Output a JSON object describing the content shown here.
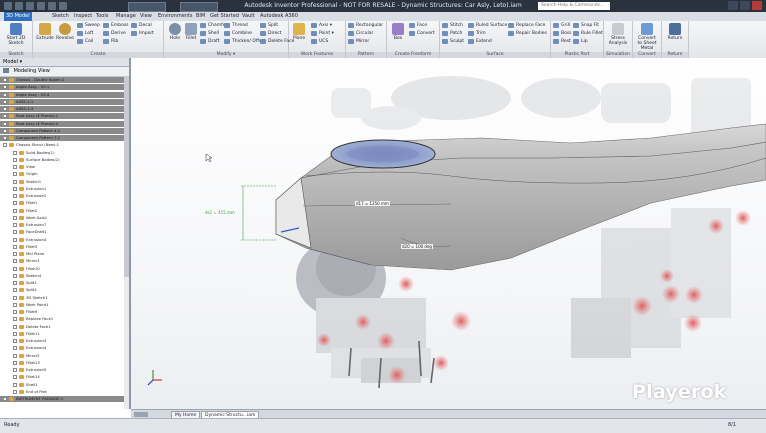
{
  "app": {
    "title": "Autodesk Inventor Professional  -  NOT FOR RESALE  -  Dynamic Structures: Car Asly, Leto).iam",
    "search_placeholder": "Search Help & Commands..."
  },
  "ribbon_tabs": [
    "3D Model",
    "Sketch",
    "Inspect",
    "Tools",
    "Manage",
    "View",
    "Environments",
    "BIM",
    "Get Started",
    "Vault",
    "Autodesk A360"
  ],
  "ribbon": {
    "sketch": {
      "label": "Sketch",
      "start_sketch": "Start 2D Sketch"
    },
    "create": {
      "label": "Create",
      "extrude": "Extrude",
      "revolve": "Revolve",
      "sweep": "Sweep",
      "loft": "Loft",
      "coil": "Coil",
      "emboss": "Emboss",
      "derive": "Derive",
      "rib": "Rib",
      "decal": "Decal",
      "import": "Import"
    },
    "modify": {
      "label": "Modify ▾",
      "hole": "Hole",
      "fillet": "Fillet",
      "chamfer": "Chamfer",
      "shell": "Shell",
      "draft": "Draft",
      "thread": "Thread",
      "combine": "Combine",
      "thicken": "Thicken/ Offset",
      "split": "Split",
      "direct": "Direct",
      "delete_face": "Delete Face"
    },
    "work_features": {
      "label": "Work Features",
      "plane": "Plane",
      "axis": "Axis ▾",
      "point": "Point ▾",
      "ucs": "UCS"
    },
    "pattern": {
      "label": "Pattern",
      "rectangular": "Rectangular",
      "circular": "Circular",
      "mirror": "Mirror"
    },
    "create_freeform": {
      "label": "Create Freeform",
      "box": "Box",
      "face": "Face",
      "convert": "Convert"
    },
    "surface": {
      "label": "Surface",
      "stitch": "Stitch",
      "patch": "Patch",
      "sculpt": "Sculpt",
      "ruled": "Ruled Surface",
      "trim": "Trim",
      "extend": "Extend",
      "replace": "Replace Face",
      "repair": "Repair Bodies"
    },
    "plastic_part": {
      "label": "Plastic Part",
      "grill": "Grill",
      "boss": "Boss",
      "rest": "Rest",
      "snap_fit": "Snap Fit",
      "rule_fillet": "Rule Fillet",
      "lip": "Lip"
    },
    "simulation": {
      "label": "Simulation",
      "stress": "Stress Analysis"
    },
    "convert": {
      "label": "Convert",
      "to_sheet": "Convert to Sheet Metal"
    },
    "return": {
      "label": "Return",
      "return": "Return"
    }
  },
  "browser": {
    "header": "Model ▾",
    "view": "Modeling View",
    "nodes": [
      {
        "t": "Chassis - Double Kuben:1",
        "d": 0,
        "hl": true
      },
      {
        "t": "Angle Assy - V2:1",
        "d": 0,
        "hl": true
      },
      {
        "t": "Angle Assy - V2:4",
        "d": 0,
        "hl": true
      },
      {
        "t": "ASSS-1:1",
        "d": 0,
        "hl": true
      },
      {
        "t": "ASSS-1:3",
        "d": 0,
        "hl": true
      },
      {
        "t": "Seat Assy (4 Places):1",
        "d": 0,
        "hl": true
      },
      {
        "t": "Seat Assy (4 Places):4",
        "d": 0,
        "hl": true
      },
      {
        "t": "Component Pattern 4:1",
        "d": 0,
        "hl": true
      },
      {
        "t": "Component Pattern 7:1",
        "d": 0,
        "hl": true
      },
      {
        "t": "Chassis Strcut (New):1",
        "d": 0,
        "hl": false
      },
      {
        "t": "Solid Bodies(1)",
        "d": 1,
        "hl": false
      },
      {
        "t": "Surface Bodies(2)",
        "d": 1,
        "hl": false
      },
      {
        "t": "View",
        "d": 1,
        "hl": false
      },
      {
        "t": "Origin",
        "d": 1,
        "hl": false
      },
      {
        "t": "Sketch1",
        "d": 1,
        "hl": false
      },
      {
        "t": "Extrusion1",
        "d": 1,
        "hl": false
      },
      {
        "t": "Extrusion2",
        "d": 1,
        "hl": false
      },
      {
        "t": "Fillet1",
        "d": 1,
        "hl": false
      },
      {
        "t": "Fillet2",
        "d": 1,
        "hl": false
      },
      {
        "t": "Work Axis1",
        "d": 1,
        "hl": false
      },
      {
        "t": "Extrusion7",
        "d": 1,
        "hl": false
      },
      {
        "t": "FaceDraft1",
        "d": 1,
        "hl": false
      },
      {
        "t": "Extrusion4",
        "d": 1,
        "hl": false
      },
      {
        "t": "Fillet3",
        "d": 1,
        "hl": false
      },
      {
        "t": "Mid Plane",
        "d": 1,
        "hl": false
      },
      {
        "t": "Mirror1",
        "d": 1,
        "hl": false
      },
      {
        "t": "Fillet10",
        "d": 1,
        "hl": false
      },
      {
        "t": "Sketch4",
        "d": 1,
        "hl": false
      },
      {
        "t": "Split1",
        "d": 1,
        "hl": false
      },
      {
        "t": "Split2",
        "d": 1,
        "hl": false
      },
      {
        "t": "3D Sketch1",
        "d": 1,
        "hl": false
      },
      {
        "t": "Work Point1",
        "d": 1,
        "hl": false
      },
      {
        "t": "Fillet9",
        "d": 1,
        "hl": false
      },
      {
        "t": "Replace Face1",
        "d": 1,
        "hl": false
      },
      {
        "t": "Delete Face1",
        "d": 1,
        "hl": false
      },
      {
        "t": "Fillet11",
        "d": 1,
        "hl": false
      },
      {
        "t": "Extrusion3",
        "d": 1,
        "hl": false
      },
      {
        "t": "Extrusion4",
        "d": 1,
        "hl": false
      },
      {
        "t": "Mirror2",
        "d": 1,
        "hl": false
      },
      {
        "t": "Fillet13",
        "d": 1,
        "hl": false
      },
      {
        "t": "Extrusion5",
        "d": 1,
        "hl": false
      },
      {
        "t": "Fillet14",
        "d": 1,
        "hl": false
      },
      {
        "t": "Shell1",
        "d": 1,
        "hl": false
      },
      {
        "t": "End of Part",
        "d": 1,
        "hl": false
      },
      {
        "t": "INSTRUMENT PACKAGE:1",
        "d": 0,
        "hl": true
      }
    ]
  },
  "viewport": {
    "dim1": "ds1 = 415 mm",
    "dim2": "d17 = 1250 mm",
    "dim3": "d20 = 100 deg"
  },
  "doc_tabs": [
    "My Home",
    "Dynamic Structu...iam"
  ],
  "status": {
    "left": "Ready",
    "right": "8/1"
  },
  "watermark": "Playerok",
  "colors": {
    "accent": "#2f6fbf",
    "highlight": "#8a8a8a",
    "titlebar": "#2a3240"
  }
}
